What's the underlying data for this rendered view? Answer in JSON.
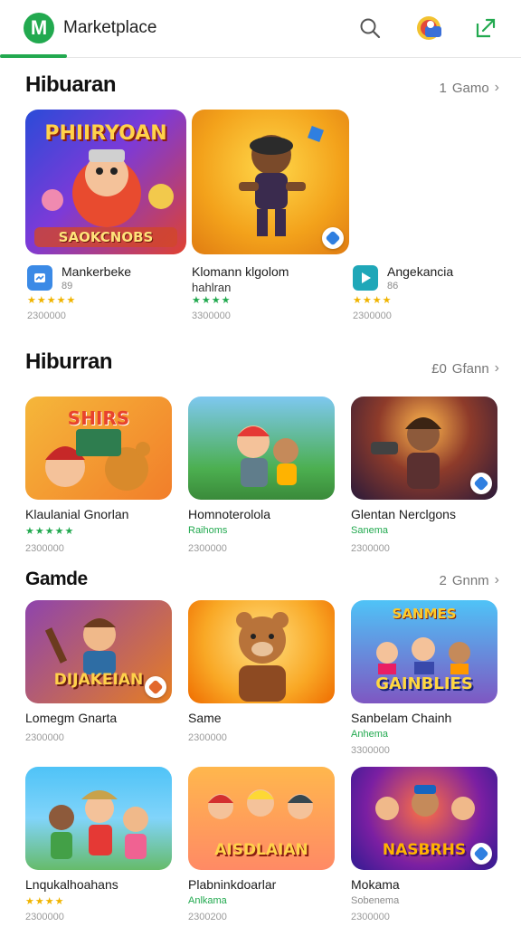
{
  "header": {
    "logo_letter": "M",
    "title": "Marketplace",
    "accent_color": "#22a94f"
  },
  "sections": [
    {
      "title": "Hibuaran",
      "link_count": "1",
      "link_label": "Gamo",
      "cards": [
        {
          "art_text": "PHIIRYOAN",
          "art_text2": "SAOKCNOBS",
          "name": "Mankerbeke",
          "sub": "89",
          "stars": "★★★★★",
          "meta": "2300000"
        },
        {
          "name": "Klomann klgolom",
          "sub": "hahlran",
          "stars": "★★★★",
          "meta": "3300000"
        },
        {
          "name": "Angekancia",
          "sub": "86",
          "stars": "★★★★",
          "meta": "2300000"
        }
      ]
    },
    {
      "title": "Hiburran",
      "link_count": "£0",
      "link_label": "Gfann",
      "cards": [
        {
          "art_text": "SHIRS",
          "name": "Klaulanial Gnorlan",
          "sub": "",
          "stars": "★★★★★",
          "meta": "2300000"
        },
        {
          "name": "Homnoterolola",
          "sub": "Raihoms",
          "stars": "",
          "meta": "2300000"
        },
        {
          "name": "Glentan Nerclgons",
          "sub": "Sanema",
          "stars": "",
          "meta": "2300000"
        }
      ]
    },
    {
      "title": "Gamde",
      "link_count": "2",
      "link_label": "Gnnm",
      "cards": [
        {
          "art_text": "DIJAKEIAN",
          "name": "Lomegm Gnarta",
          "sub": "",
          "stars": "",
          "meta": "2300000"
        },
        {
          "name": "Same",
          "sub": "",
          "stars": "",
          "meta": "2300000"
        },
        {
          "art_text": "SANMES",
          "art_text2": "GAINBLIES",
          "name": "Sanbelam Chainh",
          "sub": "Anhema",
          "stars": "",
          "meta": "3300000"
        }
      ]
    },
    {
      "title": "",
      "cards": [
        {
          "name": "Lnqukalhoahans",
          "sub": "",
          "stars": "★★★★",
          "meta": "2300000"
        },
        {
          "art_text": "AISDLAIAN",
          "name": "Plabninkdoarlar",
          "sub": "Anlkama",
          "stars": "",
          "meta": "2300200"
        },
        {
          "art_text": "NASBRHS",
          "name": "Mokama",
          "sub": "Sobenema",
          "stars": "",
          "meta": "2300000"
        }
      ]
    }
  ]
}
